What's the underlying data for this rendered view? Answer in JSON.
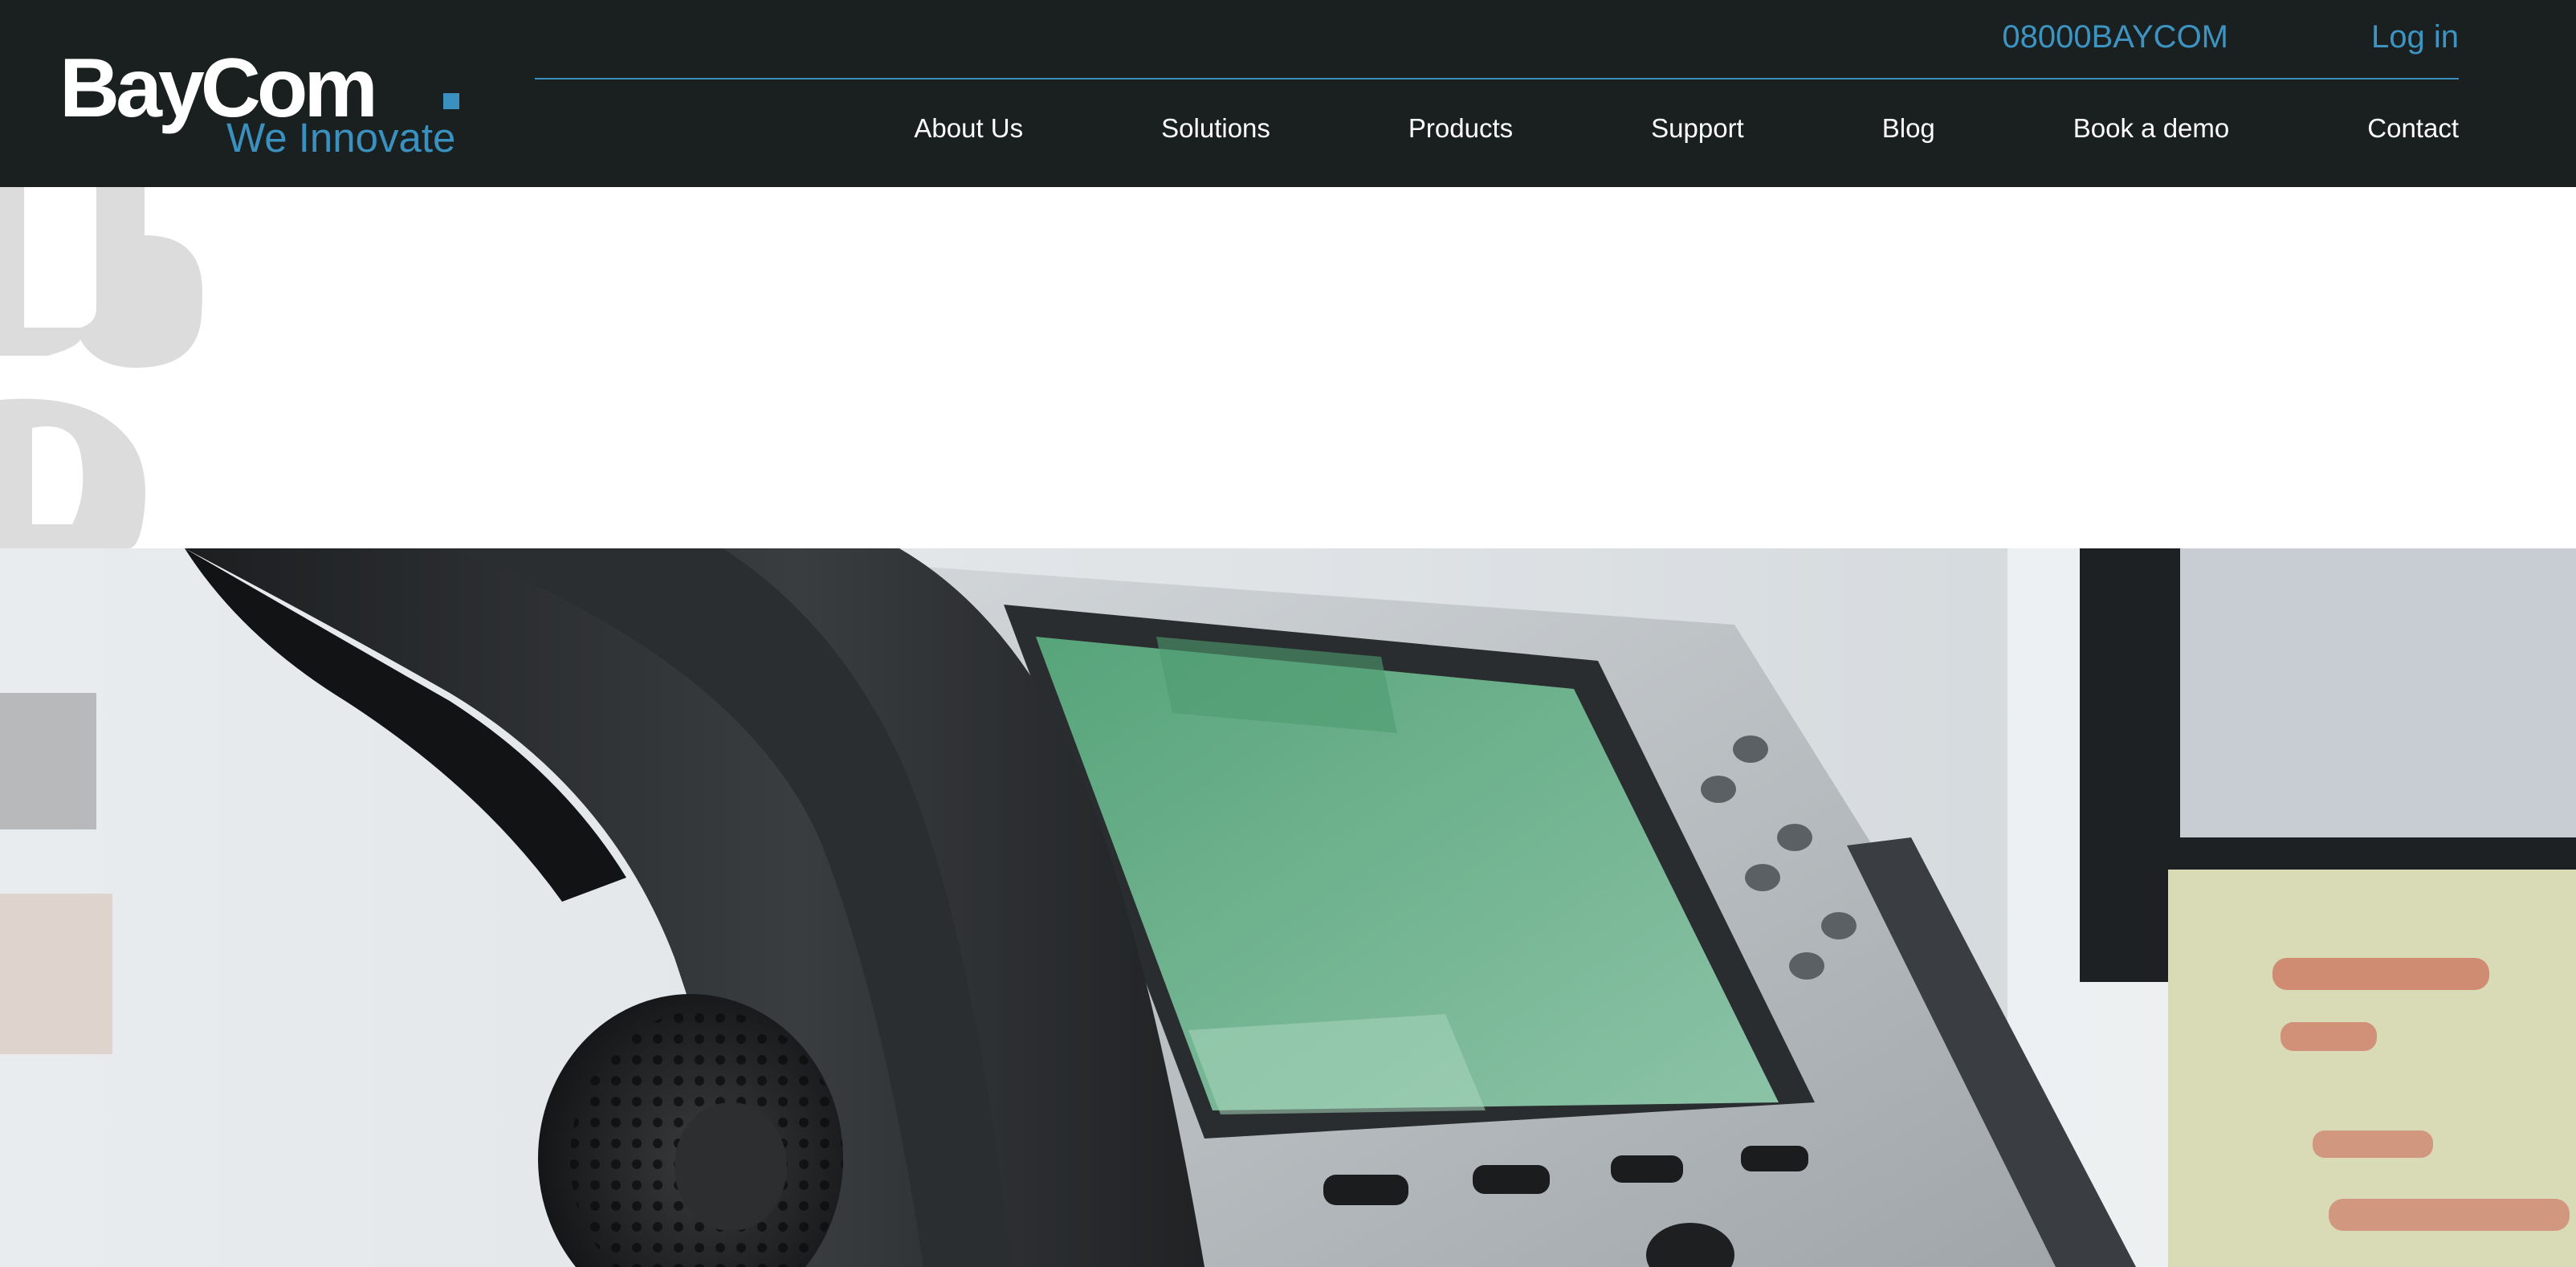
{
  "header": {
    "logo": {
      "name": "BayCom",
      "tagline": "We Innovate"
    },
    "phone": "08000BAYCOM",
    "login_label": "Log in",
    "nav": [
      {
        "label": "About Us"
      },
      {
        "label": "Solutions"
      },
      {
        "label": "Products"
      },
      {
        "label": "Support"
      },
      {
        "label": "Blog"
      },
      {
        "label": "Book a demo"
      },
      {
        "label": "Contact"
      }
    ]
  },
  "hero": {
    "image": "office-desk-phone-photo"
  },
  "colors": {
    "header_bg": "#1a201f",
    "accent": "#3a90bf",
    "nav_text": "#ffffff"
  }
}
